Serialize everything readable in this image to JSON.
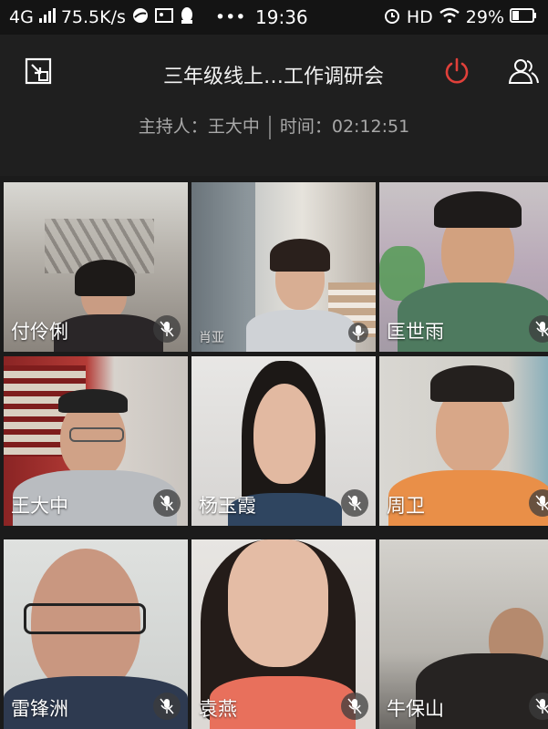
{
  "status_bar": {
    "network": "4G",
    "speed": "75.5K/s",
    "time": "19:36",
    "hd": "HD",
    "battery": "29%"
  },
  "header": {
    "title": "三年级线上…工作调研会",
    "host_label": "主持人",
    "host_name": "王大中",
    "time_label": "时间",
    "elapsed": "02:12:51"
  },
  "participants": [
    {
      "name": "付伶俐"
    },
    {
      "name": "肖亚"
    },
    {
      "name": "匡世雨"
    },
    {
      "name": "王大中"
    },
    {
      "name": "杨玉霞"
    },
    {
      "name": "周卫"
    },
    {
      "name": "雷锋洲"
    },
    {
      "name": "袁燕"
    },
    {
      "name": "牛保山"
    }
  ],
  "colors": {
    "end_button": "#e0403a",
    "background": "#1b1b1b"
  }
}
